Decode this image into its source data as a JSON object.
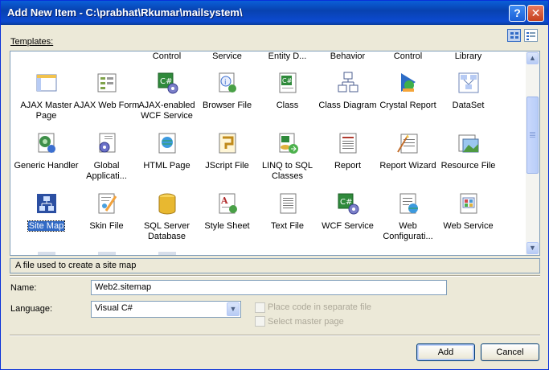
{
  "window": {
    "title": "Add New Item - C:\\prabhat\\Rkumar\\mailsystem\\",
    "help_glyph": "?",
    "close_glyph": "✕"
  },
  "templates_label": "Templates:",
  "top_row": [
    "Control",
    "Service",
    "Entity D...",
    "Behavior",
    "Control",
    "Library"
  ],
  "items": [
    {
      "label": "AJAX Master Page",
      "icon": "master-page-icon"
    },
    {
      "label": "AJAX Web Form",
      "icon": "web-form-icon"
    },
    {
      "label": "AJAX-enabled WCF Service",
      "icon": "csharp-gear-icon"
    },
    {
      "label": "Browser File",
      "icon": "browser-file-icon"
    },
    {
      "label": "Class",
      "icon": "class-file-icon"
    },
    {
      "label": "Class Diagram",
      "icon": "class-diagram-icon"
    },
    {
      "label": "Crystal Report",
      "icon": "crystal-report-icon"
    },
    {
      "label": "DataSet",
      "icon": "dataset-icon"
    },
    {
      "label": "Generic Handler",
      "icon": "generic-handler-icon"
    },
    {
      "label": "Global Applicati...",
      "icon": "global-app-icon"
    },
    {
      "label": "HTML Page",
      "icon": "html-page-icon"
    },
    {
      "label": "JScript File",
      "icon": "jscript-file-icon"
    },
    {
      "label": "LINQ to SQL Classes",
      "icon": "linq-sql-icon"
    },
    {
      "label": "Report",
      "icon": "report-icon"
    },
    {
      "label": "Report Wizard",
      "icon": "report-wizard-icon"
    },
    {
      "label": "Resource File",
      "icon": "resource-file-icon"
    },
    {
      "label": "Site Map",
      "icon": "site-map-icon",
      "selected": true
    },
    {
      "label": "Skin File",
      "icon": "skin-file-icon"
    },
    {
      "label": "SQL Server Database",
      "icon": "database-icon"
    },
    {
      "label": "Style Sheet",
      "icon": "style-sheet-icon"
    },
    {
      "label": "Text File",
      "icon": "text-file-icon"
    },
    {
      "label": "WCF Service",
      "icon": "wcf-service-icon"
    },
    {
      "label": "Web Configurati...",
      "icon": "web-config-icon"
    },
    {
      "label": "Web Service",
      "icon": "web-service-icon"
    }
  ],
  "description": "A file used to create a site map",
  "name_label": "Name:",
  "name_value": "Web2.sitemap",
  "language_label": "Language:",
  "language_value": "Visual C#",
  "place_code_label": "Place code in separate file",
  "select_master_label": "Select master page",
  "add_label": "Add",
  "cancel_label": "Cancel",
  "colors": {
    "title_blue": "#0a5fd8",
    "selection": "#316ac5",
    "face": "#ece9d8",
    "border": "#7f9db9"
  }
}
